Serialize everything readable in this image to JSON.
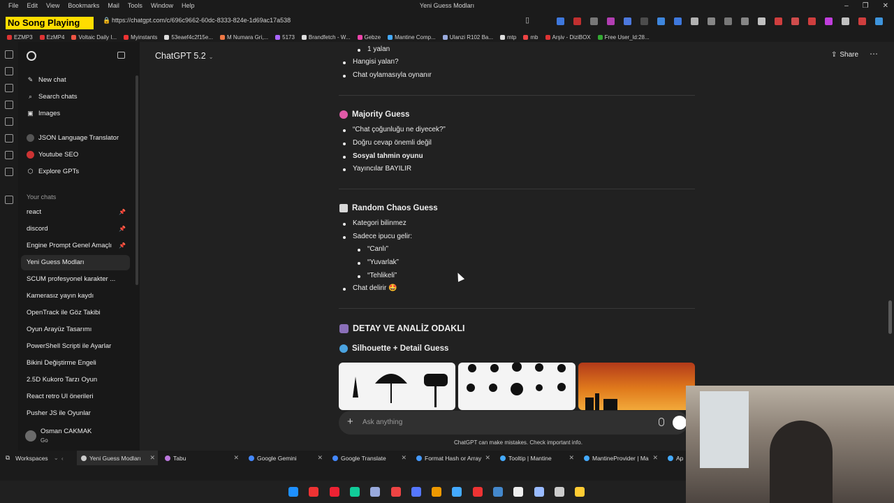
{
  "menubar": {
    "items": [
      "File",
      "Edit",
      "View",
      "Bookmarks",
      "Mail",
      "Tools",
      "Window",
      "Help"
    ],
    "window_title": "Yeni Guess Modları"
  },
  "overlay": {
    "song": "No Song Playing"
  },
  "address": {
    "url": "https://chatgpt.com/c/696c9662-60dc-8333-824e-1d69ac17a538"
  },
  "bookmarks": [
    {
      "label": "EZMP3",
      "color": "#d33"
    },
    {
      "label": "EzMP4",
      "color": "#d33"
    },
    {
      "label": "Voltaic Daily I...",
      "color": "#e54"
    },
    {
      "label": "Myinstants",
      "color": "#e33"
    },
    {
      "label": "53eaef4c2f15e...",
      "color": "#ddd"
    },
    {
      "label": "M Numara Gri,...",
      "color": "#e74"
    },
    {
      "label": "5173",
      "color": "#a6f"
    },
    {
      "label": "Brandfetch - W...",
      "color": "#ddd"
    },
    {
      "label": "Gebze",
      "color": "#e4a"
    },
    {
      "label": "Mantine Comp...",
      "color": "#4af"
    },
    {
      "label": "Ulanzi R102 Ba...",
      "color": "#9ad"
    },
    {
      "label": "mtp",
      "color": "#ddd"
    },
    {
      "label": "mb",
      "color": "#e44"
    },
    {
      "label": "Arşiv - DiziBOX",
      "color": "#d33"
    },
    {
      "label": "Free User_ld:28...",
      "color": "#3a3"
    }
  ],
  "sidebar": {
    "nav": [
      {
        "label": "New chat",
        "icon": "edit-icon"
      },
      {
        "label": "Search chats",
        "icon": "search-icon"
      },
      {
        "label": "Images",
        "icon": "image-icon"
      }
    ],
    "gpts": [
      {
        "label": "JSON Language Translator"
      },
      {
        "label": "Youtube SEO"
      },
      {
        "label": "Explore GPTs"
      }
    ],
    "section_title": "Your chats",
    "chats": [
      {
        "label": "react",
        "pinned": true
      },
      {
        "label": "discord",
        "pinned": true
      },
      {
        "label": "Engine Prompt Genel Amaçlı",
        "pinned": true
      },
      {
        "label": "Yeni Guess Modları",
        "active": true
      },
      {
        "label": "SCUM profesyonel karakter ..."
      },
      {
        "label": "Kamerasız yayın kaydı"
      },
      {
        "label": "OpenTrack ile Göz Takibi"
      },
      {
        "label": "Oyun Arayüz Tasarımı"
      },
      {
        "label": "PowerShell Scripti ile Ayarlar"
      },
      {
        "label": "Bikini Değiştirme Engeli"
      },
      {
        "label": "2.5D Kukoro Tarzı Oyun"
      },
      {
        "label": "React retro UI önerileri"
      },
      {
        "label": "Pusher JS ile Oyunlar"
      }
    ],
    "user": {
      "name": "Osman CAKMAK",
      "plan": "Go"
    }
  },
  "header": {
    "model": "ChatGPT 5.2",
    "share": "Share"
  },
  "content": {
    "top_items": {
      "sub": "1 yalan",
      "items": [
        "Hangisi yalan?",
        "Chat oylamasıyla oynanır"
      ]
    },
    "majority": {
      "title": "Majority Guess",
      "items": [
        "“Chat çoğunluğu ne diyecek?”",
        "Doğru cevap önemli değil",
        "Sosyal tahmin oyunu",
        "Yayıncılar BAYILIR"
      ]
    },
    "chaos": {
      "title": "Random Chaos Guess",
      "items": [
        "Kategori bilinmez",
        "Sadece ipucu gelir:"
      ],
      "subs": [
        "“Canlı”",
        "“Yuvarlak”",
        "“Tehlikeli”"
      ],
      "last": "Chat delirir 🤩"
    },
    "section2": {
      "title": "DETAY VE ANALİZ ODAKLI",
      "sub_title": "Silhouette + Detail Guess"
    }
  },
  "composer": {
    "placeholder": "Ask anything",
    "disclaimer": "ChatGPT can make mistakes. Check important info."
  },
  "tabs": {
    "workspaces": "Workspaces",
    "items": [
      {
        "label": "Yeni Guess Modları",
        "color": "#ccc",
        "active": true
      },
      {
        "label": "Tabu",
        "color": "#b7d"
      },
      {
        "label": "Google Gemini",
        "color": "#48f"
      },
      {
        "label": "Google Translate",
        "color": "#48f"
      },
      {
        "label": "Format Hash or Array",
        "color": "#49f"
      },
      {
        "label": "Tooltip | Mantine",
        "color": "#4af"
      },
      {
        "label": "MantineProvider | Ma",
        "color": "#4af"
      },
      {
        "label": "Ap",
        "color": "#4af"
      }
    ]
  },
  "taskbar": [
    "#1e90ff",
    "#e33",
    "#e23",
    "#1c9",
    "#9ad",
    "#e44",
    "#57f",
    "#e90",
    "#4af",
    "#e33",
    "#48c",
    "#eee",
    "#9bf",
    "#ccc",
    "#fc3"
  ]
}
